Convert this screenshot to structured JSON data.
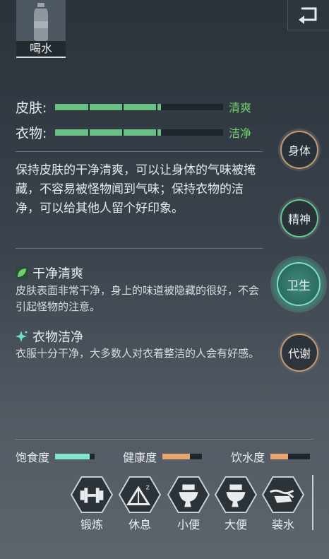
{
  "header": {
    "back_icon": "return-icon"
  },
  "hygiene": {
    "stats": [
      {
        "label": "皮肤:",
        "value_word": "清爽",
        "fill": 0.63
      },
      {
        "label": "衣物:",
        "value_word": "洁净",
        "fill": 0.63
      }
    ],
    "description": "保持皮肤的干净清爽，可以让身体的气味被掩藏，不容易被怪物闻到气味；保持衣物的洁净，可以给其他人留个好印象。",
    "buffs": [
      {
        "icon": "leaf-icon",
        "title": "干净清爽",
        "desc": "皮肤表面非常干净，身上的味道被隐藏的很好，不会引起怪物的注意。"
      },
      {
        "icon": "sparkle-icon",
        "title": "衣物洁净",
        "desc": "衣服十分干净，大多数人对衣着整洁的人会有好感。"
      }
    ]
  },
  "categories": [
    {
      "label": "身体",
      "active": false
    },
    {
      "label": "精神",
      "active": false
    },
    {
      "label": "卫生",
      "active": true
    },
    {
      "label": "代谢",
      "active": false
    }
  ],
  "needs": [
    {
      "label": "饱食度",
      "fill": 0.88,
      "color": "#7fe6c8"
    },
    {
      "label": "健康度",
      "fill": 0.7,
      "color": "#e6a56c"
    },
    {
      "label": "饮水度",
      "fill": 0.45,
      "color": "#e6a56c"
    }
  ],
  "actions": [
    {
      "label": "喝水",
      "icon": "water-bottle-icon",
      "selected": true
    },
    {
      "label": "锻炼",
      "icon": "dumbbell-icon"
    },
    {
      "label": "休息",
      "icon": "tent-sleep-icon"
    },
    {
      "label": "小便",
      "icon": "toilet-icon"
    },
    {
      "label": "大便",
      "icon": "toilet-icon"
    },
    {
      "label": "装水",
      "icon": "water-refill-icon"
    }
  ],
  "colors": {
    "accent_green": "#6fd06a",
    "bar_green": "#6cbf85",
    "teal_active": "#7fe0c4",
    "ring_brown": "#c69b6d"
  }
}
